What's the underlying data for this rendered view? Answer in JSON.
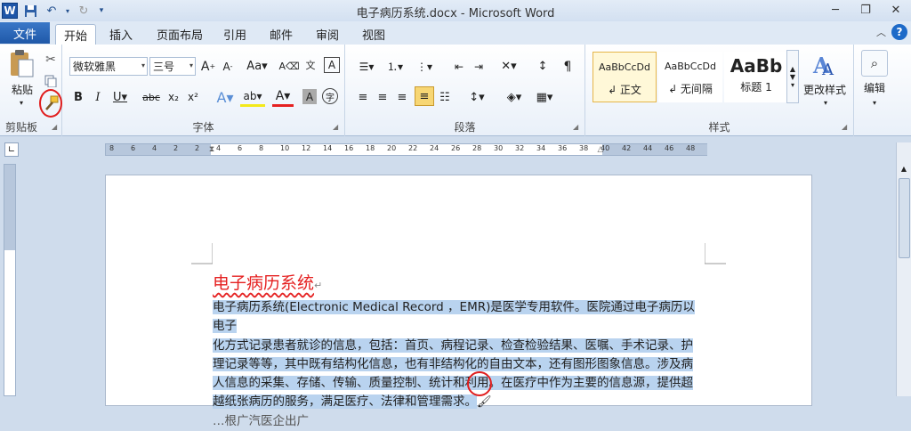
{
  "window": {
    "title": "电子病历系统.docx - Microsoft Word"
  },
  "qat": {
    "logo": "W",
    "save_icon": "save-icon",
    "undo_icon": "undo-icon",
    "redo_icon": "redo-icon"
  },
  "tabs": {
    "file": "文件",
    "items": [
      "开始",
      "插入",
      "页面布局",
      "引用",
      "邮件",
      "审阅",
      "视图"
    ],
    "active": "开始"
  },
  "clipboard": {
    "paste": "粘贴",
    "label": "剪贴板"
  },
  "font": {
    "name": "微软雅黑",
    "size": "三号",
    "label": "字体"
  },
  "paragraph": {
    "label": "段落"
  },
  "styles": {
    "label": "样式",
    "cards": [
      {
        "preview": "AaBbCcDd",
        "name": "↲ 正文"
      },
      {
        "preview": "AaBbCcDd",
        "name": "↲ 无间隔"
      },
      {
        "preview": "AaBb",
        "name": "标题 1"
      }
    ],
    "change": "更改样式"
  },
  "editing": {
    "label": "编辑"
  },
  "ruler": {
    "ticks": [
      "8",
      "6",
      "4",
      "2",
      "2",
      "4",
      "6",
      "8",
      "10",
      "12",
      "14",
      "16",
      "18",
      "20",
      "22",
      "24",
      "26",
      "28",
      "30",
      "32",
      "34",
      "36",
      "38",
      "40",
      "42",
      "44",
      "46",
      "48"
    ]
  },
  "document": {
    "title": "电子病历系统",
    "lines": [
      "电子病历系统(Electronic Medical Record ，EMR)是医学专用软件。医院通过电子病历以电子",
      "化方式记录患者就诊的信息，包括：首页、病程记录、检查检验结果、医嘱、手术记录、护",
      "理记录等等，其中既有结构化信息，也有非结构化的自由文本，还有图形图象信息。涉及病",
      "人信息的采集、存储、传输、质量控制、统计和利用。在医疗中作为主要的信息源，提供超",
      "越纸张病历的服务，满足医疗、法律和管理需求。",
      "…根广汽医企出广"
    ]
  },
  "colors": {
    "accent": "#1f58a8",
    "highlight": "#b9d3ef",
    "title_red": "#e52121",
    "circle": "#e11d1d"
  }
}
